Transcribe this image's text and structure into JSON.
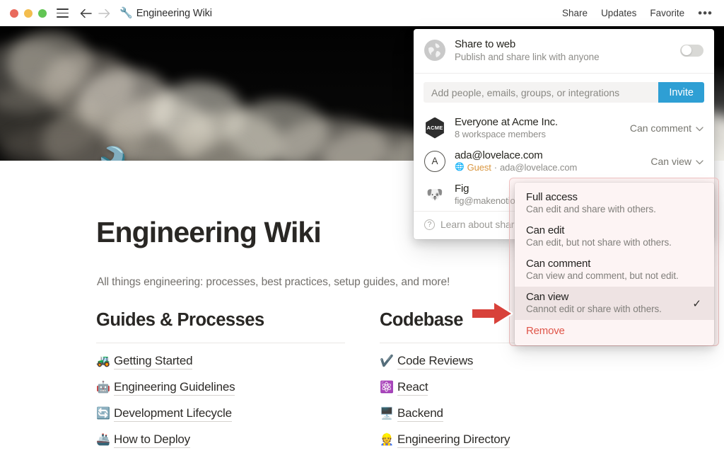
{
  "titlebar": {
    "window_controls": [
      "close",
      "minimize",
      "maximize"
    ],
    "menu_icon": "hamburger-icon",
    "back_icon": "arrow-left-icon",
    "forward_icon": "arrow-right-icon",
    "doc_emoji": "🔧",
    "doc_title": "Engineering Wiki",
    "actions": [
      {
        "label": "Share",
        "name": "share-button"
      },
      {
        "label": "Updates",
        "name": "updates-button"
      },
      {
        "label": "Favorite",
        "name": "favorite-button"
      }
    ],
    "more_label": "•••"
  },
  "page": {
    "cover_alt": "rocket launch with smoke plume",
    "icon_emoji": "🔧",
    "title": "Engineering Wiki",
    "subtitle": "All things engineering: processes, best practices, setup guides, and more!",
    "columns": [
      {
        "heading": "Guides & Processes",
        "links": [
          {
            "emoji": "🚜",
            "label": "Getting Started"
          },
          {
            "emoji": "🤖",
            "label": "Engineering Guidelines"
          },
          {
            "emoji": "🔄",
            "label": "Development Lifecycle"
          },
          {
            "emoji": "🚢",
            "label": "How to Deploy"
          }
        ]
      },
      {
        "heading": "Codebase",
        "links": [
          {
            "emoji": "✔️",
            "label": "Code Reviews"
          },
          {
            "emoji": "⚛️",
            "label": "React"
          },
          {
            "emoji": "🖥️",
            "label": "Backend"
          },
          {
            "emoji": "👷",
            "label": "Engineering Directory"
          }
        ]
      }
    ]
  },
  "share_popover": {
    "share_to_web": {
      "icon": "globe-icon",
      "title": "Share to web",
      "subtitle": "Publish and share link with anyone",
      "toggle_on": false
    },
    "invite": {
      "placeholder": "Add people, emails, groups, or integrations",
      "value": "",
      "button_label": "Invite",
      "button_color": "#2e9fd4"
    },
    "people": [
      {
        "avatar_type": "acme-badge",
        "avatar_text": "ACME",
        "name": "Everyone at Acme Inc.",
        "sub": "8 workspace members",
        "permission": "Can comment"
      },
      {
        "avatar_type": "letter-circle",
        "avatar_text": "A",
        "name": "ada@lovelace.com",
        "guest_label": "Guest",
        "sub_separator": "·",
        "sub_email": "ada@lovelace.com",
        "permission": "Can view"
      },
      {
        "avatar_type": "dog-emoji",
        "avatar_text": "🐶",
        "name": "Fig",
        "sub": "fig@makenotio",
        "permission": ""
      }
    ],
    "footer": {
      "icon": "question-circle-icon",
      "label": "Learn about sharin"
    }
  },
  "permission_menu": {
    "highlight_color": "#f0c2c2",
    "items": [
      {
        "title": "Full access",
        "desc": "Can edit and share with others.",
        "selected": false
      },
      {
        "title": "Can edit",
        "desc": "Can edit, but not share with others.",
        "selected": false
      },
      {
        "title": "Can comment",
        "desc": "Can view and comment, but not edit.",
        "selected": false
      },
      {
        "title": "Can view",
        "desc": "Cannot edit or share with others.",
        "selected": true
      }
    ],
    "check_glyph": "✓",
    "remove_label": "Remove",
    "remove_color": "#e0564a"
  },
  "annotation": {
    "arrow": "red-right-arrow",
    "arrow_color": "#d8413a"
  }
}
